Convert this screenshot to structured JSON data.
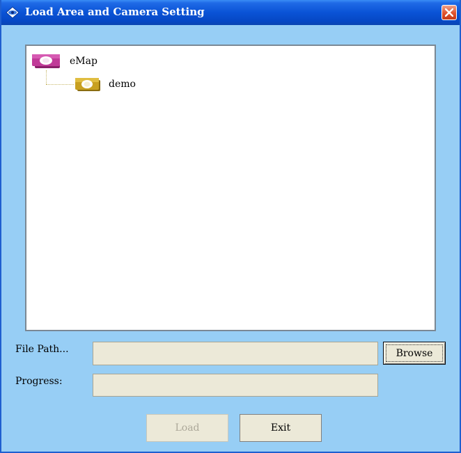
{
  "window": {
    "title": "Load Area and Camera Setting",
    "title_icon": "diamond-eye-icon",
    "close_icon": "close-icon"
  },
  "tree": {
    "root": {
      "label": "eMap",
      "icon": "map-camera-icon",
      "color": "#b0308a"
    },
    "children": [
      {
        "label": "demo",
        "icon": "area-camera-icon",
        "color": "#c8a020"
      }
    ]
  },
  "form": {
    "file_path_label": "File Path...",
    "file_path_value": "",
    "progress_label": "Progress:",
    "progress_value": 0
  },
  "buttons": {
    "browse": "Browse",
    "load": "Load",
    "exit": "Exit"
  },
  "colors": {
    "window_bg": "#97cef5",
    "titlebar": "#0a53d6",
    "field_bg": "#ece9d8"
  }
}
